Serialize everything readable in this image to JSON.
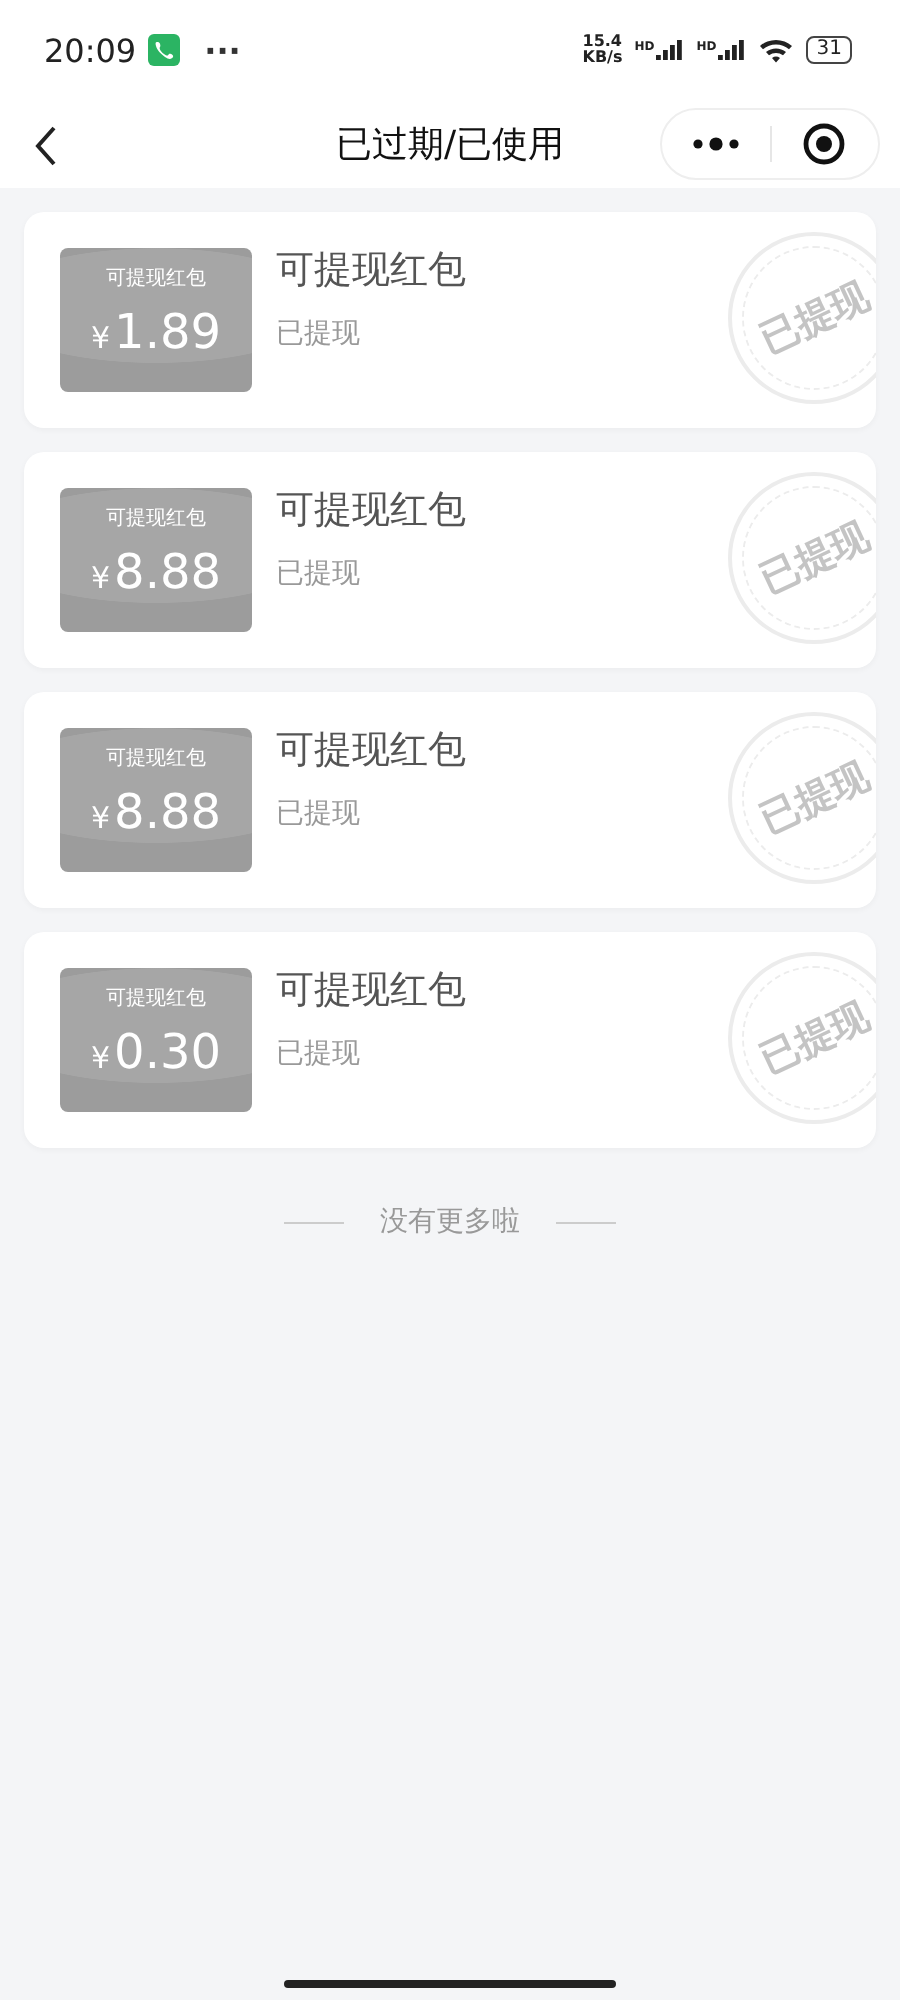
{
  "status_bar": {
    "time": "20:09",
    "more": "···",
    "speed": "15.4",
    "speed_unit": "KB/s",
    "signal_label_1": "HD",
    "signal_label_2": "HD",
    "battery": "31"
  },
  "nav": {
    "title": "已过期/已使用"
  },
  "coupons": [
    {
      "badge_title": "可提现红包",
      "currency": "¥",
      "amount": "1.89",
      "title": "可提现红包",
      "status": "已提现",
      "stamp": "已提现",
      "used": true
    },
    {
      "badge_title": "可提现红包",
      "currency": "¥",
      "amount": "8.88",
      "title": "可提现红包",
      "status": "已提现",
      "stamp": "已提现",
      "used": true
    },
    {
      "badge_title": "可提现红包",
      "currency": "¥",
      "amount": "8.88",
      "title": "可提现红包",
      "status": "已提现",
      "stamp": "已提现",
      "used": true
    },
    {
      "badge_title": "可提现红包",
      "currency": "¥",
      "amount": "0.30",
      "title": "可提现红包",
      "status": "已提现",
      "stamp": "已提现",
      "used": true
    }
  ],
  "footer": {
    "end_text": "没有更多啦"
  }
}
